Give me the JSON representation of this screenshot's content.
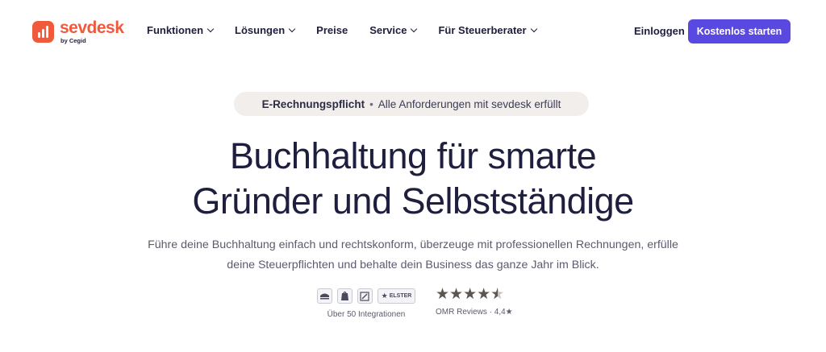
{
  "brand": {
    "name": "sevdesk",
    "sub": "by Cegid",
    "accent": "#f05a3c",
    "cta_color": "#5a49e0"
  },
  "nav": {
    "items": [
      {
        "label": "Funktionen",
        "has_dropdown": true
      },
      {
        "label": "Lösungen",
        "has_dropdown": true
      },
      {
        "label": "Preise",
        "has_dropdown": false
      },
      {
        "label": "Service",
        "has_dropdown": true
      },
      {
        "label": "Für Steuerberater",
        "has_dropdown": true
      }
    ],
    "login_label": "Einloggen",
    "cta_label": "Kostenlos starten"
  },
  "hero": {
    "pill_bold": "E-Rechnungspflicht",
    "pill_separator": "•",
    "pill_text": "Alle Anforderungen mit sevdesk erfüllt",
    "title_line1": "Buchhaltung für smarte",
    "title_line2": "Gründer und Selbstständige",
    "subtitle_line1": "Führe deine Buchhaltung einfach und rechtskonform, überzeuge mit professionellen Rechnungen, erfülle",
    "subtitle_line2": "deine Steuerpflichten und behalte dein Business das ganze Jahr im Blick."
  },
  "trust": {
    "integrations": {
      "icons": [
        "datev-icon",
        "shopify-icon",
        "slash-icon",
        "elster-icon"
      ],
      "elster_text": "ELSTER",
      "label": "Über 50 Integrationen"
    },
    "reviews": {
      "rating_value": 4.4,
      "rating_max": 5,
      "label": "OMR Reviews · 4,4★"
    }
  }
}
